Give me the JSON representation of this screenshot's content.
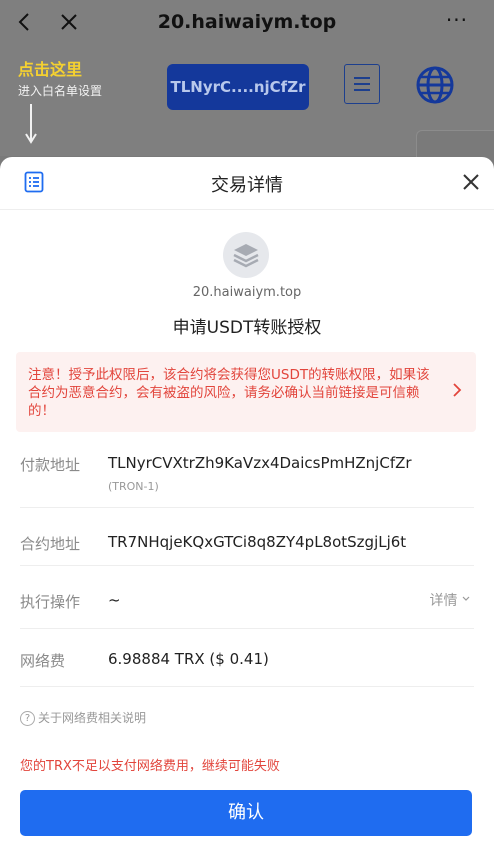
{
  "browser": {
    "url": "20.haiwaiym.top",
    "more_label": "···"
  },
  "dapp": {
    "tip_title": "点击这里",
    "tip_sub": "进入白名单设置",
    "address_button": "TLNyrC....njCfZr"
  },
  "sheet": {
    "title": "交易详情",
    "domain": "20.haiwaiym.top",
    "request_title": "申请USDT转账授权",
    "warning": "注意！授予此权限后，该合约将会获得您USDT的转账权限，如果该合约为恶意合约，会有被盗的风险，请务必确认当前链接是可信赖的！",
    "rows": {
      "payer": {
        "label": "付款地址",
        "value": "TLNyrCVXtrZh9KaVzx4DaicsPmHZnjCfZr",
        "sub": "(TRON-1)"
      },
      "contract": {
        "label": "合约地址",
        "value": "TR7NHqjeKQxGTCi8q8ZY4pL8otSzgjLj6t"
      },
      "operation": {
        "label": "执行操作",
        "value": "~",
        "detail": "详情"
      },
      "fee": {
        "label": "网络费",
        "value": "6.98884 TRX ($ 0.41)"
      }
    },
    "fee_help": "关于网络费相关说明",
    "error": "您的TRX不足以支付网络费用，继续可能失败",
    "confirm_label": "确认"
  },
  "colors": {
    "primary": "#1f6cf0",
    "warning": "#e2453c",
    "tip_yellow": "#f5d130",
    "overlay": "#7f7f7f"
  }
}
